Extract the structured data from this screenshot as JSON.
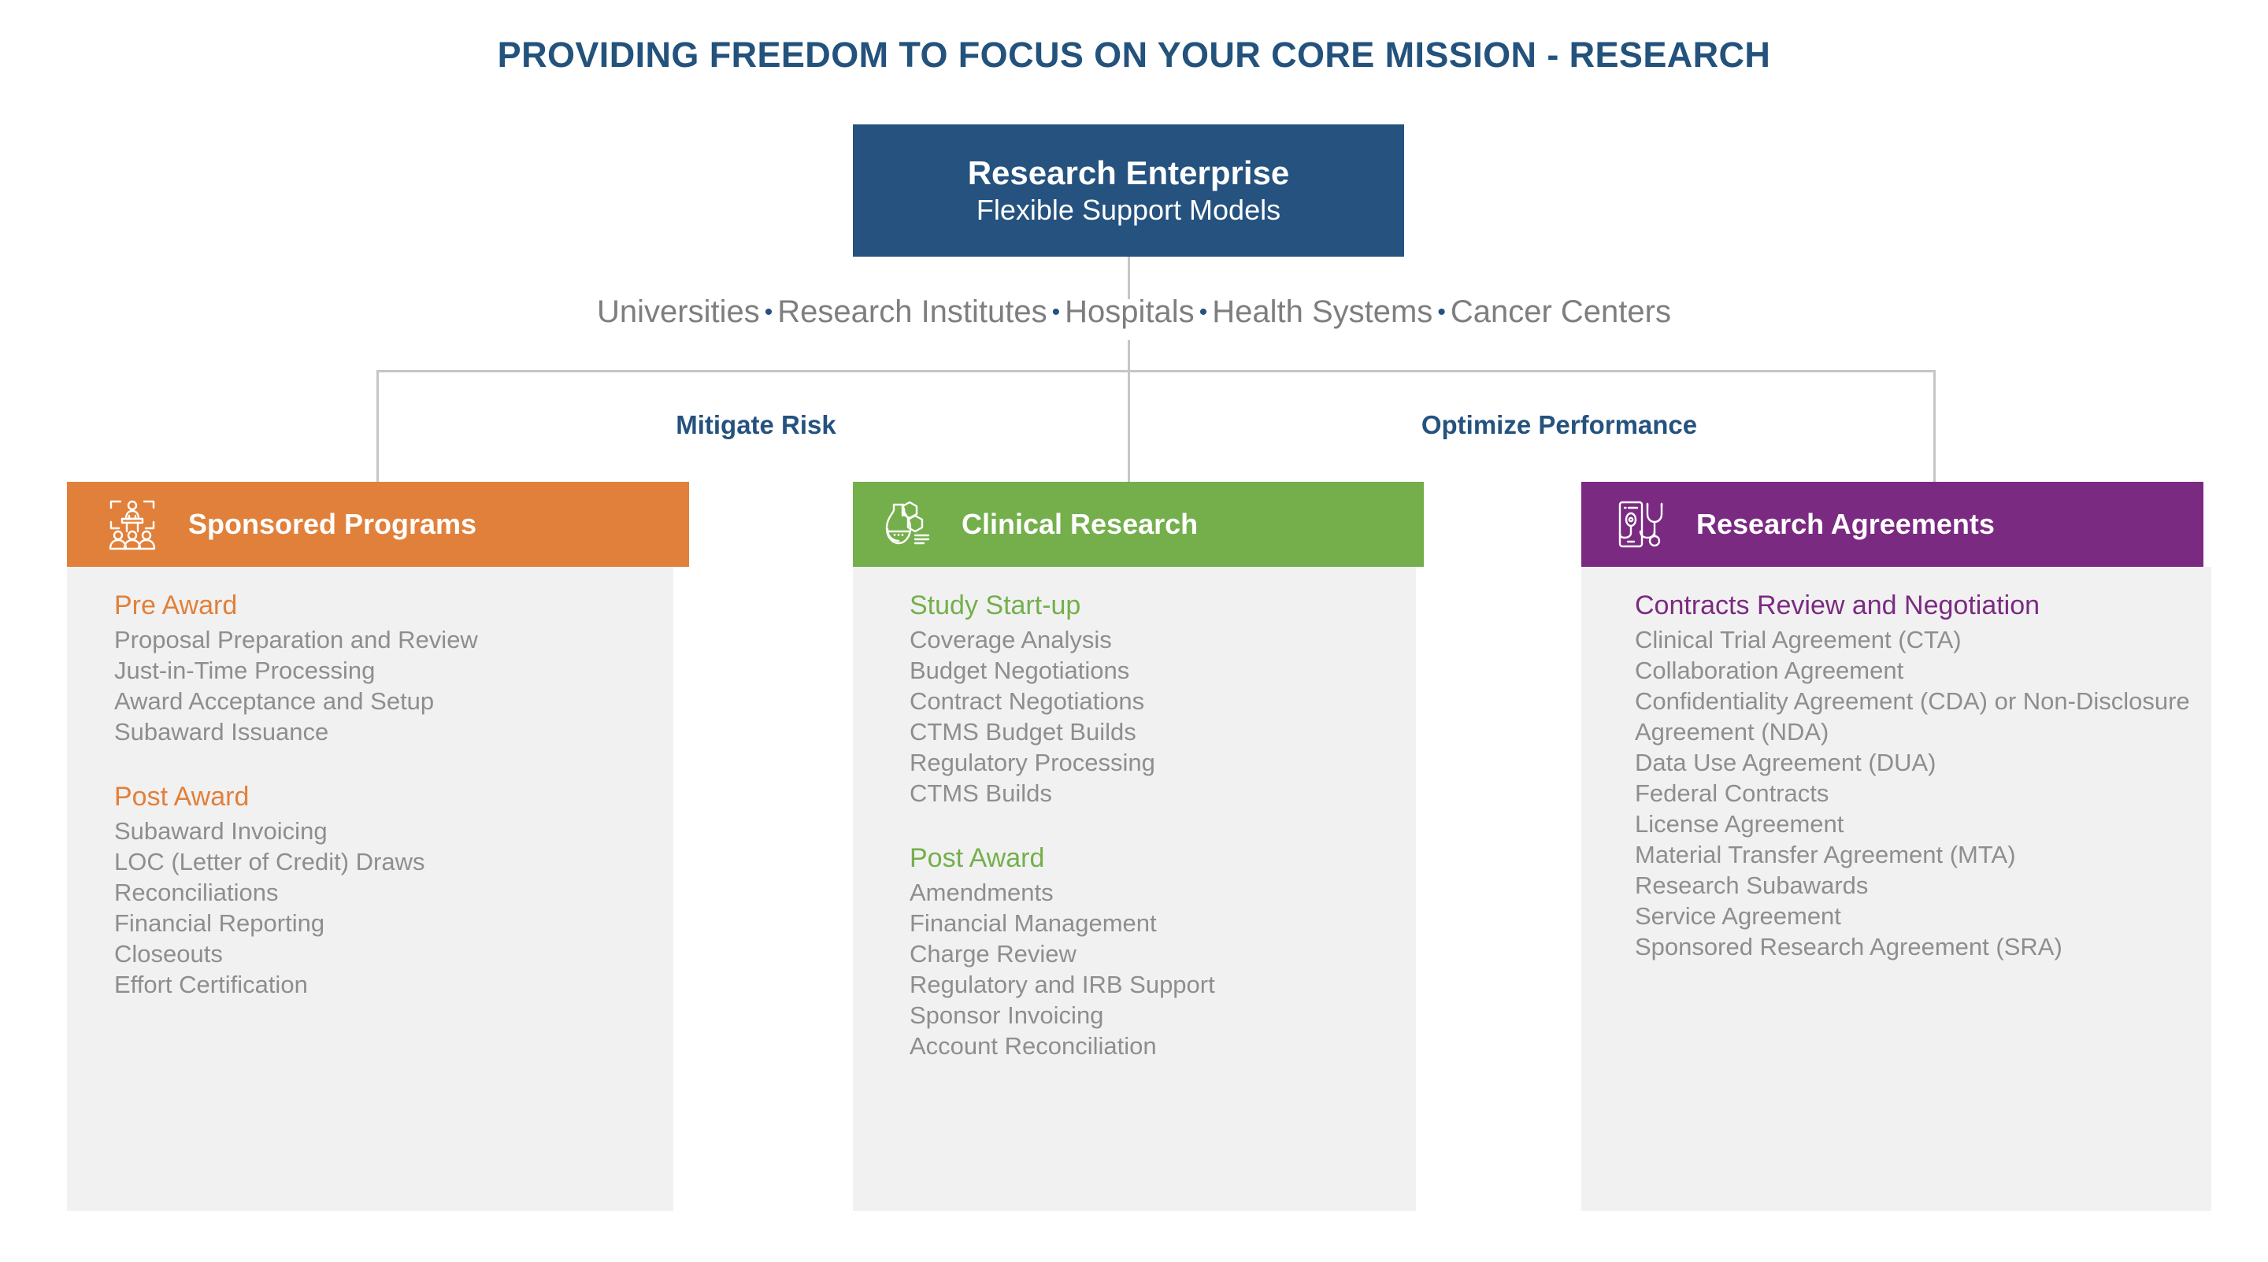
{
  "title": "PROVIDING FREEDOM TO FOCUS ON YOUR CORE MISSION - RESEARCH",
  "root": {
    "title": "Research Enterprise",
    "subtitle": "Flexible Support Models"
  },
  "audience": {
    "items": [
      "Universities",
      "Research Institutes",
      "Hospitals",
      "Health Systems",
      "Cancer Centers"
    ],
    "separator": "•"
  },
  "branches": {
    "left_label": "Mitigate Risk",
    "right_label": "Optimize Performance"
  },
  "colors": {
    "title_blue": "#23527C",
    "root_blue": "#25527E",
    "orange": "#E1803A",
    "green": "#74AF4C",
    "purple": "#7B2A82",
    "panel_gray": "#F1F1F1",
    "body_text_gray": "#8E8E8E",
    "audience_gray": "#7E7E7E",
    "connector_gray": "#C6C6C6"
  },
  "columns": [
    {
      "header": "Sponsored Programs",
      "icon": "presentation-audience-icon",
      "accent": "#E1803A",
      "sections": [
        {
          "title": "Pre Award",
          "items": [
            "Proposal Preparation and Review",
            "Just-in-Time Processing",
            "Award Acceptance and Setup",
            "Subaward Issuance"
          ]
        },
        {
          "title": "Post Award",
          "items": [
            "Subaward Invoicing",
            "LOC (Letter of Credit) Draws",
            "Reconciliations",
            "Financial Reporting",
            "Closeouts",
            "Effort Certification"
          ]
        }
      ]
    },
    {
      "header": "Clinical Research",
      "icon": "flask-molecule-icon",
      "accent": "#74AF4C",
      "sections": [
        {
          "title": "Study Start-up",
          "items": [
            "Coverage Analysis",
            "Budget Negotiations",
            "Contract Negotiations",
            "CTMS Budget Builds",
            "Regulatory Processing",
            "CTMS Builds"
          ]
        },
        {
          "title": "Post Award",
          "items": [
            "Amendments",
            "Financial Management",
            "Charge Review",
            "Regulatory and IRB Support",
            "Sponsor Invoicing",
            "Account Reconciliation"
          ]
        }
      ]
    },
    {
      "header": "Research Agreements",
      "icon": "phone-stethoscope-icon",
      "accent": "#7B2A82",
      "sections": [
        {
          "title": "Contracts Review and Negotiation",
          "items": [
            "Clinical Trial Agreement (CTA)",
            "Collaboration Agreement",
            "Confidentiality Agreement (CDA) or Non-Disclosure Agreement (NDA)",
            "Data Use Agreement (DUA)",
            "Federal Contracts",
            "License Agreement",
            "Material Transfer Agreement (MTA)",
            "Research Subawards",
            "Service Agreement",
            "Sponsored Research Agreement (SRA)"
          ]
        }
      ]
    }
  ]
}
